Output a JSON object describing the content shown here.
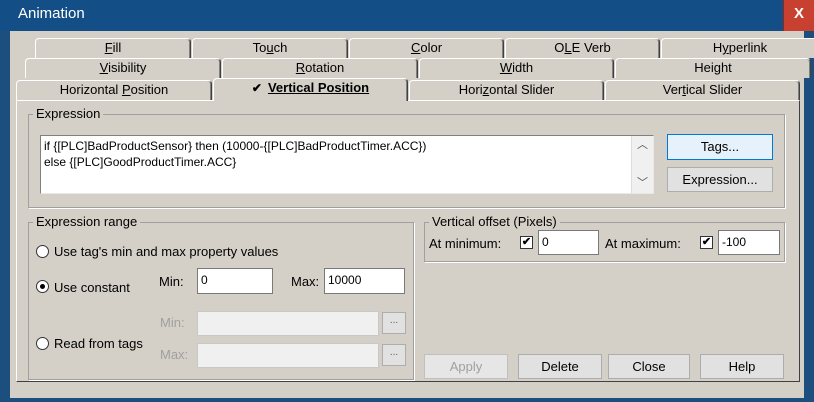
{
  "window": {
    "title": "Animation",
    "close_label": "X"
  },
  "tabs": {
    "row1": [
      {
        "label": "Fill",
        "mnemonic": "F",
        "rest": "ill"
      },
      {
        "label": "Touch",
        "pre": "To",
        "mnemonic": "u",
        "rest": "ch"
      },
      {
        "label": "Color",
        "mnemonic": "C",
        "rest": "olor"
      },
      {
        "label": "OLE Verb",
        "pre": "O",
        "mnemonic": "L",
        "rest": "E Verb"
      },
      {
        "label": "Hyperlink",
        "pre": "H",
        "mnemonic": "y",
        "rest": "perlink"
      }
    ],
    "row2": [
      {
        "label": "Visibility",
        "mnemonic": "V",
        "rest": "isibility"
      },
      {
        "label": "Rotation",
        "mnemonic": "R",
        "rest": "otation"
      },
      {
        "label": "Width",
        "mnemonic": "W",
        "rest": "idth"
      },
      {
        "label": "Height"
      }
    ],
    "row3": [
      {
        "label": "Horizontal Position",
        "pre": "Horizontal ",
        "mnemonic": "P",
        "rest": "osition"
      },
      {
        "label": "Vertical Position",
        "checkmark": "✔"
      },
      {
        "label": "Horizontal Slider",
        "pre": "Hori",
        "mnemonic": "z",
        "rest": "ontal Slider"
      },
      {
        "label": "Vertical Slider",
        "pre": "Ver",
        "mnemonic": "t",
        "rest": "ical Slider"
      }
    ]
  },
  "expression": {
    "group_label": "Expression",
    "line1": "if {[PLC]BadProductSensor} then (10000-{[PLC]BadProductTimer.ACC})",
    "line2": "else {[PLC]GoodProductTimer.ACC}",
    "tags_button": "Tags...",
    "expression_button": "Expression..."
  },
  "range": {
    "group_label": "Expression range",
    "option_minmax": "Use tag's min and max property values",
    "option_constant": "Use constant",
    "option_tags": "Read from tags",
    "selected": "constant",
    "min_label": "Min:",
    "min_value": "0",
    "max_label": "Max:",
    "max_value": "10000",
    "tag_min_label": "Min:",
    "tag_max_label": "Max:",
    "browse_label": "..."
  },
  "offset": {
    "group_label": "Vertical offset (Pixels)",
    "at_min_label": "At minimum:",
    "at_min_checked": true,
    "at_min_value": "0",
    "at_max_label": "At maximum:",
    "at_max_checked": true,
    "at_max_value": "-100"
  },
  "buttons": {
    "apply": "Apply",
    "delete": "Delete",
    "close": "Close",
    "help": "Help"
  },
  "checkmark_glyph": "✔"
}
